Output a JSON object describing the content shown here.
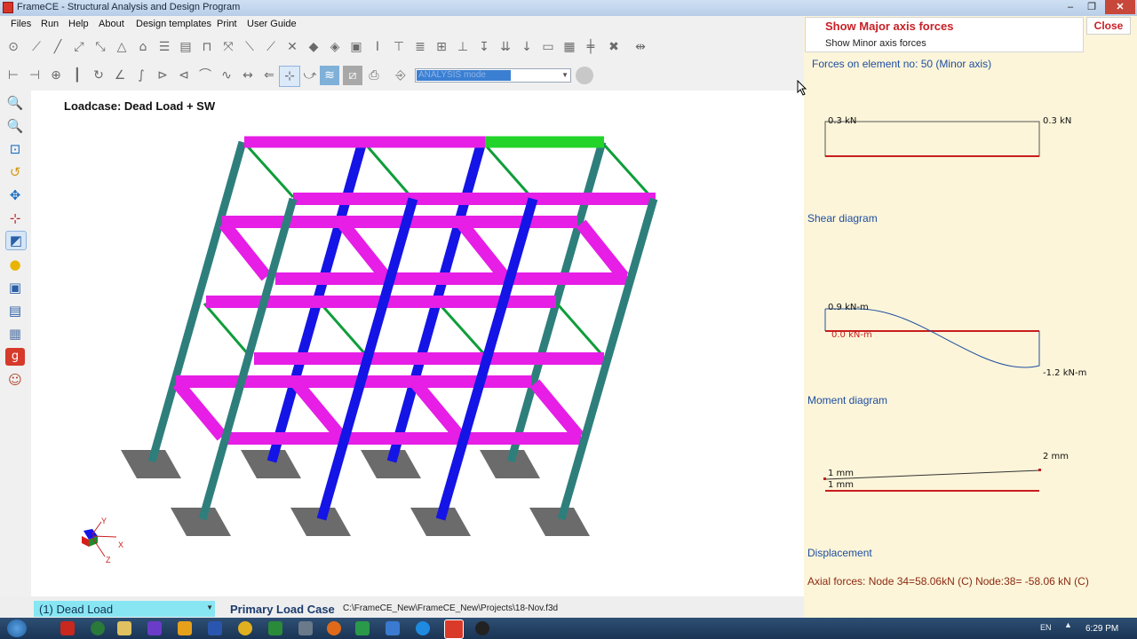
{
  "window": {
    "title": "FrameCE - Structural Analysis and Design Program",
    "minimize": "–",
    "maximize": "❐",
    "close": "✕"
  },
  "menu": [
    "Files",
    "Run",
    "Help",
    "About",
    "Design templates",
    "Print",
    "User Guide"
  ],
  "toolbar": {
    "mode_select_value": "ANALYSIS mode"
  },
  "canvas": {
    "loadcase_title": "Loadcase: Dead Load + SW",
    "axes": {
      "x": "X",
      "y": "Y",
      "z": "Z"
    }
  },
  "status": {
    "loadcase_dropdown": "(1) Dead Load",
    "primary_label": "Primary Load Case",
    "file_path": "C:\\FrameCE_New\\FrameCE_New\\Projects\\18-Nov.f3d"
  },
  "panel": {
    "show_major": "Show Major axis forces",
    "show_minor": "Show Minor axis forces",
    "close": "Close",
    "forces_on_element": "Forces on element no: 50  (Minor axis)",
    "shear": {
      "label": "Shear diagram",
      "left_value": "0.3 kN",
      "right_value": "0.3 kN"
    },
    "moment": {
      "label": "Moment diagram",
      "left_value": "0.9 kN-m",
      "zero_value": "0.0 kN-m",
      "right_value": "-1.2 kN-m"
    },
    "displacement": {
      "label": "Displacement",
      "value_a": "1 mm",
      "value_b": "1 mm",
      "right_value": "2 mm"
    },
    "axial": "Axial forces: Node 34=58.06kN  (C)   Node:38= -58.06 kN  (C)"
  },
  "taskbar": {
    "lang": "EN",
    "clock": "6:29 PM"
  },
  "colors": {
    "beam_highlight": "#e61ee6",
    "column_blue": "#1414e6",
    "column_teal": "#2e7f7c",
    "brace_green": "#0f9d3a",
    "selected_member": "#22d42a",
    "base_plate": "#6b6b6b",
    "panel_bg": "#fcf5d9",
    "axis_line": "#c81e1e"
  }
}
